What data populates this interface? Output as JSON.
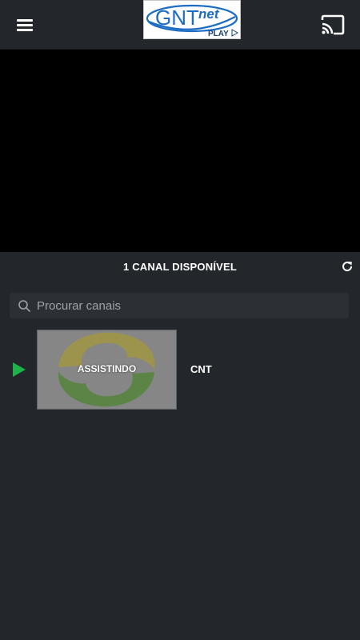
{
  "app": {
    "logo_main": "GNT",
    "logo_net": "net",
    "logo_play": "PLAY",
    "icons": {
      "menu": "hamburger-menu-icon",
      "cast": "cast-icon",
      "refresh": "refresh-icon",
      "search": "search-icon",
      "play": "play-icon"
    }
  },
  "channels": {
    "count_label": "1 CANAL DISPONÍVEL",
    "search_placeholder": "Procurar canais",
    "search_value": "",
    "items": [
      {
        "name": "CNT",
        "status_label": "ASSISTINDO",
        "playing": true
      }
    ]
  },
  "colors": {
    "background": "#23272b",
    "player": "#000000",
    "play_indicator": "#1db34a"
  }
}
